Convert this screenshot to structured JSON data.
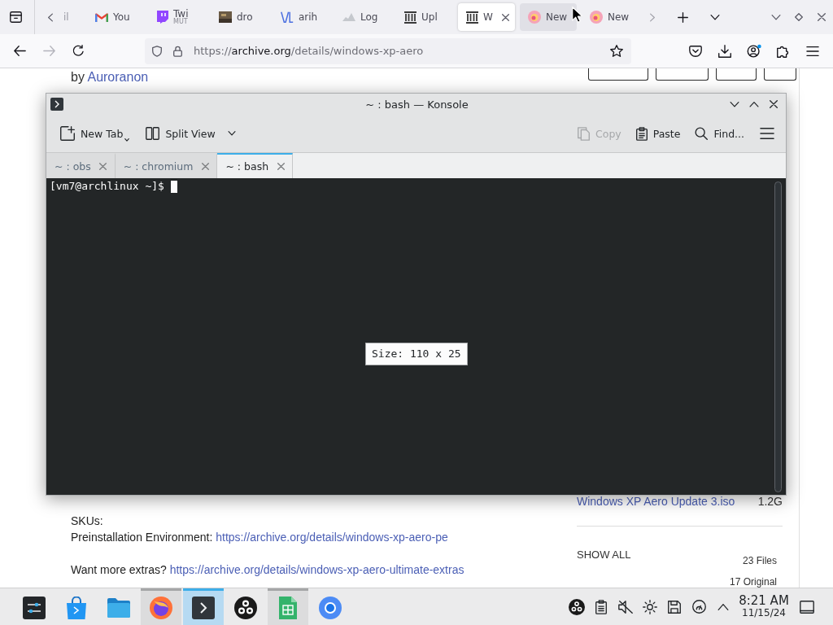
{
  "browser": {
    "tabs": [
      {
        "kind": "clipped",
        "label": "il",
        "selected": false,
        "hovered": false
      },
      {
        "kind": "tab",
        "label": "You",
        "selected": false,
        "hovered": false
      },
      {
        "kind": "tab",
        "label": "Twi",
        "sublabel": "MUT",
        "selected": false,
        "hovered": false
      },
      {
        "kind": "tab",
        "label": "dro",
        "selected": false,
        "hovered": false
      },
      {
        "kind": "tab",
        "label": "arih",
        "selected": false,
        "hovered": false
      },
      {
        "kind": "tab",
        "label": "Log",
        "selected": false,
        "hovered": false
      },
      {
        "kind": "tab",
        "label": "Upl",
        "selected": false,
        "hovered": false
      },
      {
        "kind": "tab",
        "label": "W",
        "selected": true,
        "hovered": false
      },
      {
        "kind": "tab",
        "label": "New",
        "selected": false,
        "hovered": true
      },
      {
        "kind": "tab",
        "label": "New",
        "selected": false,
        "hovered": false
      }
    ],
    "navigation": [
      {
        "disabled": false
      },
      {
        "disabled": true
      },
      {
        "disabled": false
      }
    ],
    "url": {
      "scheme": "https://",
      "host": "archive.org",
      "path": "/details/windows-xp-aero"
    }
  },
  "page": {
    "byline": {
      "prefix": "by",
      "author": "Auroranon"
    },
    "skus_heading": "SKUs:",
    "links": [
      {
        "label": "Preinstallation Environment:",
        "url": "https://archive.org/details/windows-xp-aero-pe"
      },
      {
        "label": "Want more extras?",
        "url": "https://archive.org/details/windows-xp-aero-ultimate-extras"
      }
    ],
    "files": [
      {
        "name": "Windows XP Aero Update 3.iso",
        "size": "1.2G"
      }
    ],
    "show_all": "SHOW ALL",
    "counts": [
      "23 Files",
      "17 Original"
    ]
  },
  "konsole": {
    "title": "~ : bash — Konsole",
    "toolbar": {
      "left": [
        {
          "kind": "corner-menu",
          "label": "New Tab",
          "disabled": false
        },
        {
          "kind": "dropdown",
          "label": "Split View",
          "disabled": false
        }
      ],
      "right": [
        {
          "kind": "plain",
          "label": "Copy",
          "disabled": true
        },
        {
          "kind": "plain",
          "label": "Paste",
          "disabled": false
        },
        {
          "kind": "plain",
          "label": "Find...",
          "disabled": false
        }
      ]
    },
    "tabs": [
      {
        "label": "~ : obs",
        "selected": false
      },
      {
        "label": "~ : chromium",
        "selected": false
      },
      {
        "label": "~ : bash",
        "selected": true
      }
    ],
    "terminal": {
      "prompt": "[vm7@archlinux ~]$",
      "size_overlay": "Size: 110 x 25"
    }
  },
  "taskbar": {
    "apps": [
      {
        "running": false,
        "active": false
      },
      {
        "running": false,
        "active": false
      },
      {
        "running": false,
        "active": false
      },
      {
        "running": true,
        "active": false
      },
      {
        "running": true,
        "active": true
      },
      {
        "running": false,
        "active": false
      },
      {
        "running": true,
        "active": false
      },
      {
        "running": false,
        "active": false
      }
    ],
    "clock": {
      "time": "8:21 AM",
      "date": "11/15/24"
    }
  }
}
